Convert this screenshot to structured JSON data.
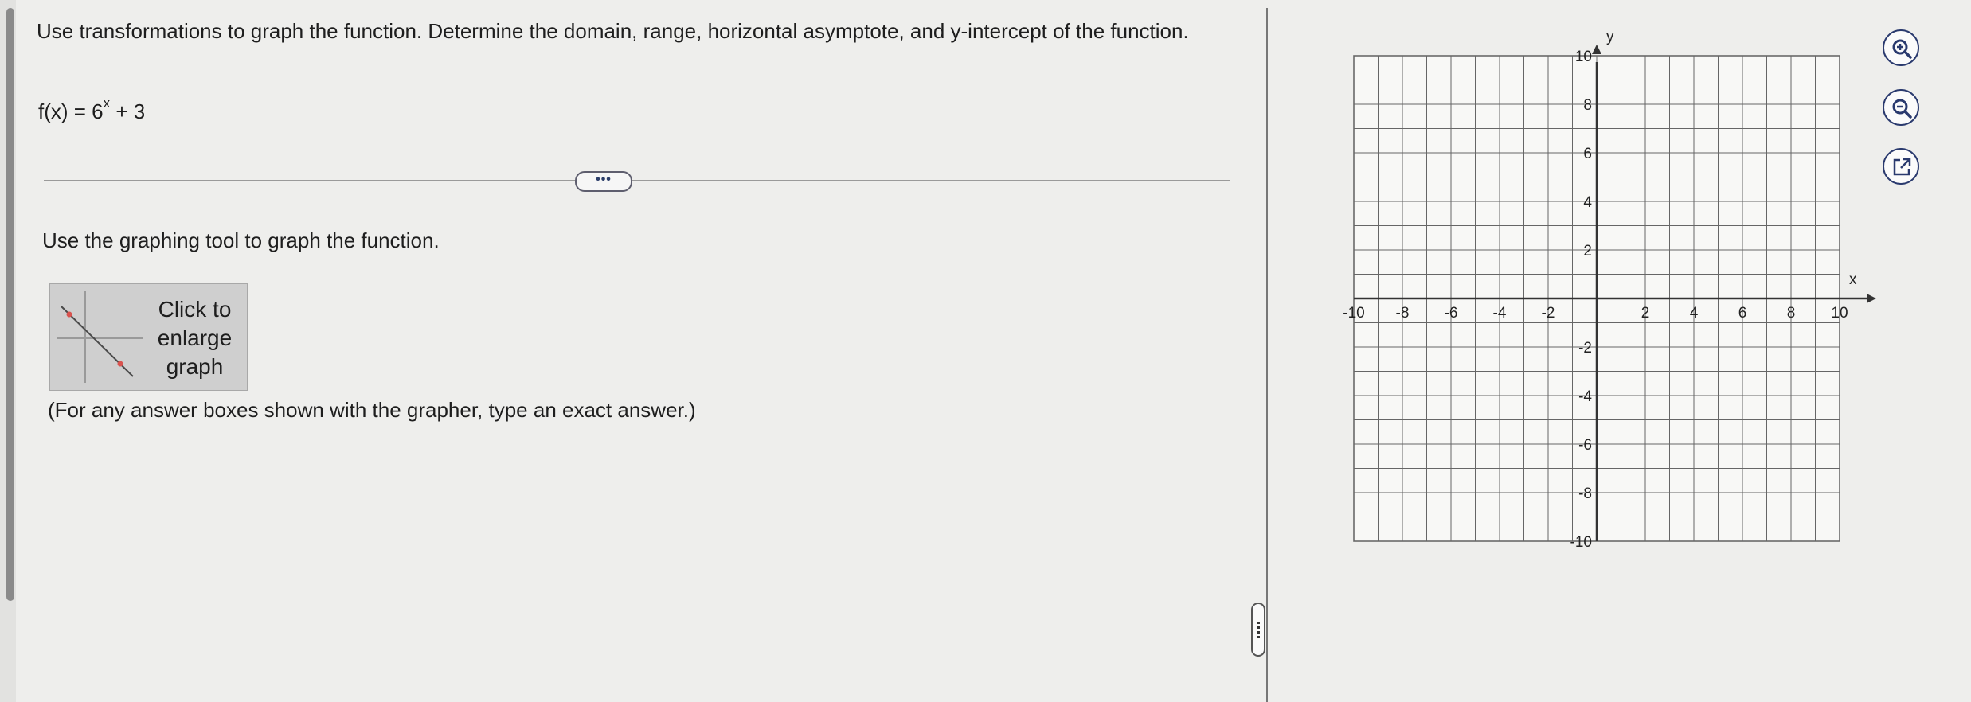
{
  "question": {
    "text": "Use transformations to graph the function. Determine the domain, range, horizontal asymptote, and y-intercept of the function.",
    "formula_prefix": "f(x) = 6",
    "formula_exponent": "x",
    "formula_suffix": " + 3"
  },
  "more_button_label": "•••",
  "instruction": "Use the graphing tool to graph the function.",
  "enlarge_button": {
    "line1": "Click to",
    "line2": "enlarge",
    "line3": "graph"
  },
  "note": "(For any answer boxes shown with the grapher, type an exact answer.)",
  "graph": {
    "x_axis_label": "x",
    "y_axis_label": "y",
    "x_range": [
      -10,
      10
    ],
    "y_range": [
      -10,
      10
    ],
    "grid_step": 1,
    "x_tick_labels": [
      "-10",
      "-8",
      "-6",
      "-4",
      "-2",
      "2",
      "4",
      "6",
      "8",
      "10"
    ],
    "y_tick_labels": [
      "10",
      "8",
      "6",
      "4",
      "2",
      "-2",
      "-4",
      "-6",
      "-8",
      "-10"
    ]
  },
  "tools": {
    "zoom_in_icon": "zoom-in-icon",
    "zoom_out_icon": "zoom-out-icon",
    "popout_icon": "external-link-icon",
    "accent_color": "#2a3a6e"
  }
}
